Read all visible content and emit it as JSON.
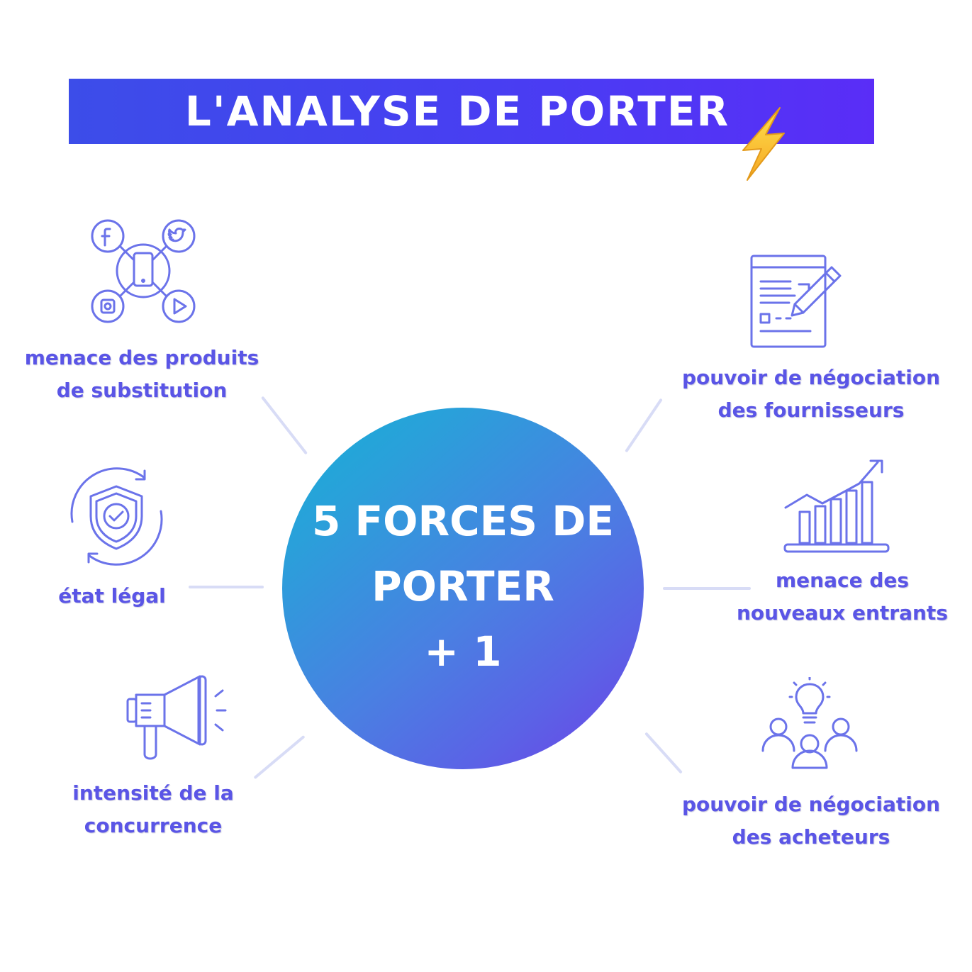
{
  "title": "L'ANALYSE DE PORTER",
  "center": {
    "line1": "5 FORCES DE",
    "line2": "PORTER",
    "line3": "+ 1"
  },
  "forces": [
    {
      "id": "substitution",
      "lines": [
        "menace des produits",
        "de substitution"
      ],
      "icon": "social-network-phone-icon"
    },
    {
      "id": "fournisseurs",
      "lines": [
        "pouvoir de négociation",
        "des fournisseurs"
      ],
      "icon": "contract-pen-icon"
    },
    {
      "id": "etat-legal",
      "lines": [
        "état légal"
      ],
      "icon": "shield-check-icon"
    },
    {
      "id": "nouveaux-entrants",
      "lines": [
        "menace des",
        "nouveaux entrants"
      ],
      "icon": "growth-chart-icon"
    },
    {
      "id": "concurrence",
      "lines": [
        "intensité de la",
        "concurrence"
      ],
      "icon": "megaphone-icon"
    },
    {
      "id": "acheteurs",
      "lines": [
        "pouvoir de négociation",
        "des acheteurs"
      ],
      "icon": "idea-people-icon"
    }
  ],
  "colors": {
    "accent": "#5a55e6",
    "icon_stroke": "#6b73ea",
    "connector": "#d8dcf6",
    "banner_start": "#3c4de9",
    "banner_end": "#5a2df7",
    "circle_start": "#16b0d6",
    "circle_end": "#6d40e8"
  }
}
